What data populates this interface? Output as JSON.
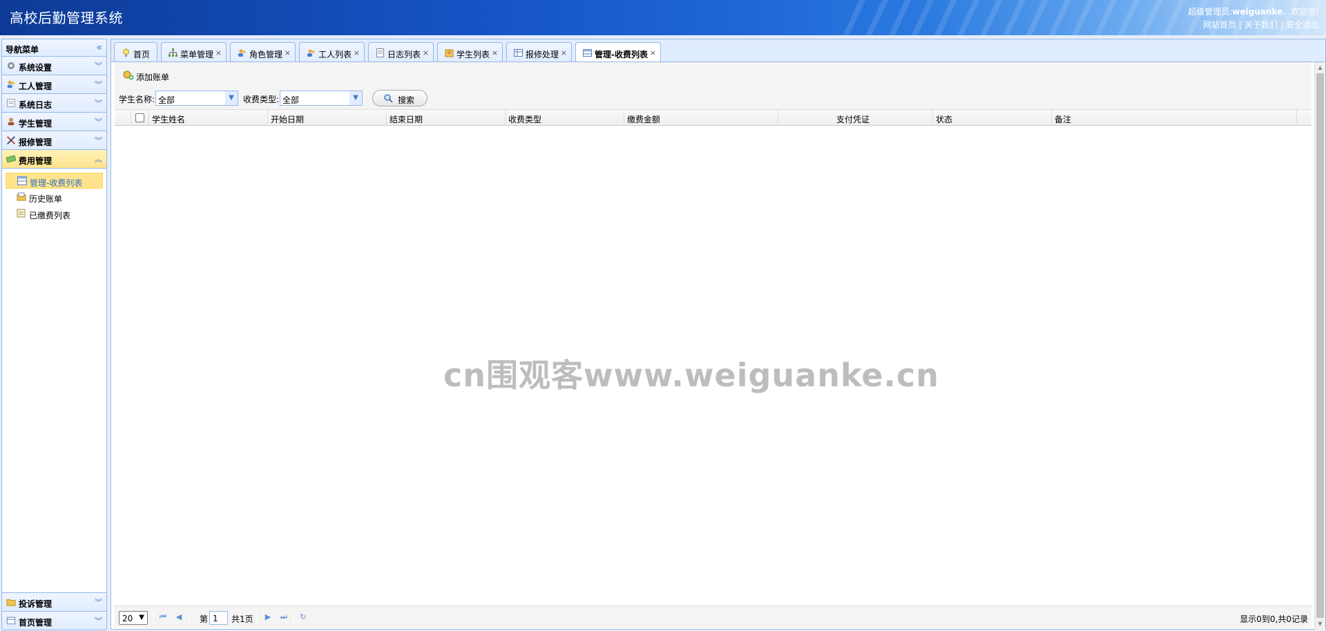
{
  "header": {
    "title": "高校后勤管理系统",
    "greeting_prefix": "超级管理员:",
    "username": "weiguanke",
    "greeting_suffix": "，欢迎您!",
    "links": [
      "网站首页",
      "关于我们",
      "安全退出"
    ],
    "link_separator": "|"
  },
  "sidebar": {
    "title": "导航菜单",
    "collapse_icon": "double-chevron-left-icon",
    "sections_top": [
      {
        "label": "系统设置",
        "icon": "gear-icon"
      },
      {
        "label": "工人管理",
        "icon": "users-icon"
      },
      {
        "label": "系统日志",
        "icon": "log-icon"
      },
      {
        "label": "学生管理",
        "icon": "student-icon"
      },
      {
        "label": "报修管理",
        "icon": "tools-icon"
      },
      {
        "label": "费用管理",
        "icon": "money-icon"
      }
    ],
    "items": [
      {
        "label": "管理-收费列表",
        "icon": "table-icon"
      },
      {
        "label": "历史账单",
        "icon": "folder-icon"
      },
      {
        "label": "已缴费列表",
        "icon": "note-icon"
      }
    ],
    "sections_bottom": [
      {
        "label": "投诉管理",
        "icon": "folder-icon"
      },
      {
        "label": "首页管理",
        "icon": "table-icon"
      }
    ]
  },
  "tabs": [
    {
      "label": "首页",
      "icon": "bulb-icon",
      "closable": false
    },
    {
      "label": "菜单管理",
      "icon": "sitemap-icon",
      "closable": true
    },
    {
      "label": "角色管理",
      "icon": "users-icon",
      "closable": true
    },
    {
      "label": "工人列表",
      "icon": "users-icon",
      "closable": true
    },
    {
      "label": "日志列表",
      "icon": "log-icon",
      "closable": true
    },
    {
      "label": "学生列表",
      "icon": "student-icon",
      "closable": true
    },
    {
      "label": "报修处理",
      "icon": "table-icon",
      "closable": true
    },
    {
      "label": "管理-收费列表",
      "icon": "table-icon",
      "closable": true
    }
  ],
  "close_glyph": "×",
  "toolbar": {
    "add_label": "添加账单",
    "student_name_label": "学生名称:",
    "student_name_value": "全部",
    "fee_type_label": "收费类型:",
    "fee_type_value": "全部",
    "search_label": "搜索"
  },
  "grid": {
    "columns": [
      "学生姓名",
      "开始日期",
      "结束日期",
      "收费类型",
      "缴费金额",
      "支付凭证",
      "状态",
      "备注"
    ],
    "rows": []
  },
  "watermark": "cn围观客www.weiguanke.cn",
  "pager": {
    "page_size": "20",
    "page_prefix": "第",
    "page_value": "1",
    "page_total": "共1页",
    "info": "显示0到0,共0记录"
  },
  "colors": {
    "accent": "#95b8e7",
    "active_bg": "#ffe48d",
    "header_dark": "#0d3a96"
  }
}
